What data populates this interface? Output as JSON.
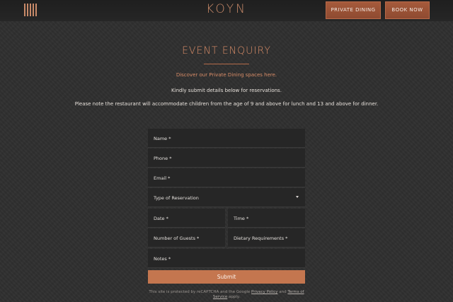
{
  "header": {
    "logo": "KOYN",
    "private_dining": "PRIVATE DINING",
    "book_now": "BOOK NOW"
  },
  "main": {
    "title": "EVENT ENQUIRY",
    "discover_link": "Discover our Private Dining spaces here.",
    "kindly_text": "Kindly submit details below for reservations.",
    "note_text": "Please note the restaurant will accommodate children from the age of 9 and above for lunch and 13 and above for dinner."
  },
  "form": {
    "name": "Name *",
    "phone": "Phone *",
    "email": "Email *",
    "reservation_type": "Type of Reservation",
    "date": "Date *",
    "time": "Time *",
    "guests": "Number of Guests *",
    "dietary": "Dietary Requirements *",
    "notes": "Notes *",
    "submit": "Submit"
  },
  "recaptcha": {
    "prefix": "This site is protected by reCAPTCHA and the Google ",
    "privacy": "Privacy Policy",
    "and": " and ",
    "terms": "Terms of Service",
    "suffix": " apply."
  }
}
